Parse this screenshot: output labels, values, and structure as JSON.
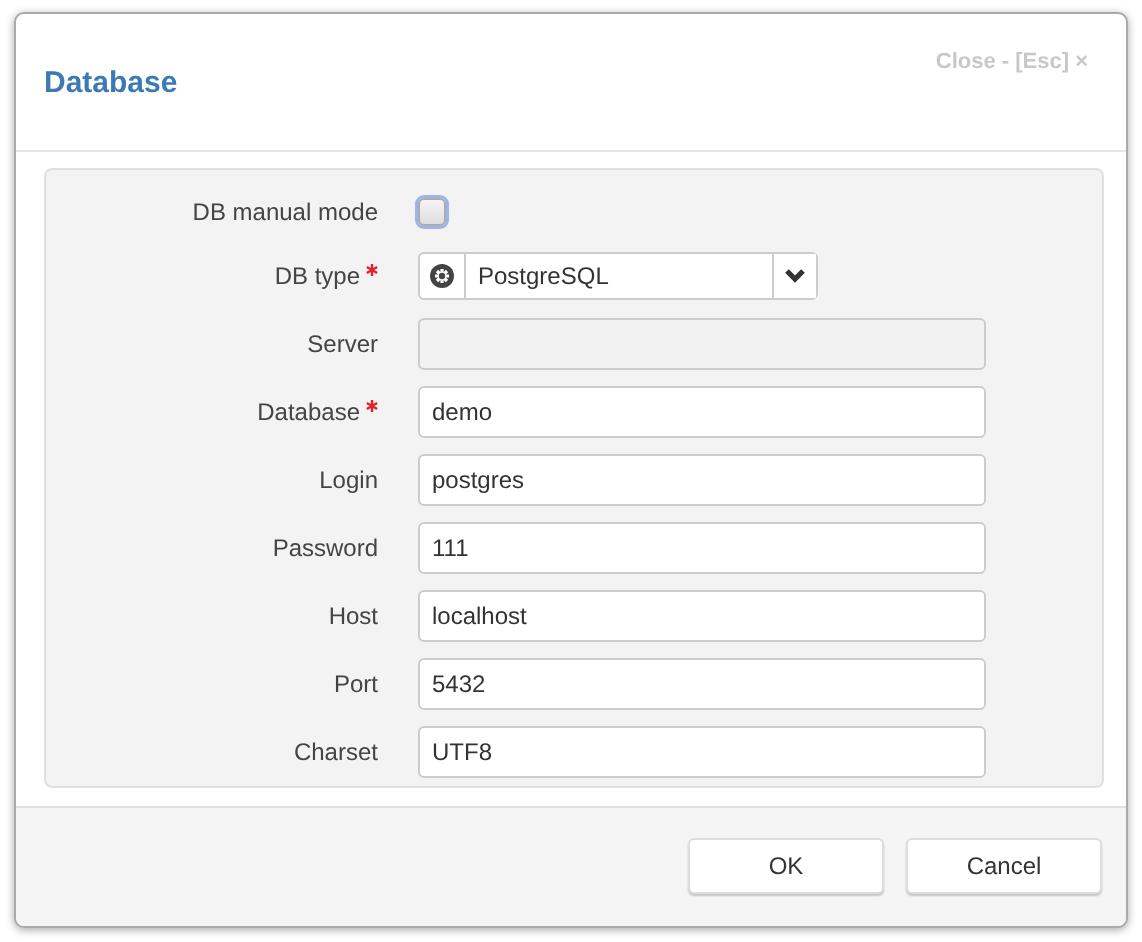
{
  "dialog": {
    "title": "Database",
    "close_label": "Close - [Esc] ×"
  },
  "fields": [
    {
      "kind": "checkbox",
      "label": "DB manual mode",
      "required": false,
      "checked": false
    },
    {
      "kind": "select",
      "label": "DB type",
      "required": true,
      "value": "PostgreSQL"
    },
    {
      "kind": "text",
      "label": "Server",
      "required": false,
      "disabled": true
    },
    {
      "kind": "text",
      "label": "Database",
      "required": true,
      "disabled": false,
      "value": "demo"
    },
    {
      "kind": "text",
      "label": "Login",
      "required": false,
      "disabled": false,
      "value": "postgres"
    },
    {
      "kind": "text",
      "label": "Password",
      "required": false,
      "disabled": false,
      "value": "111"
    },
    {
      "kind": "text",
      "label": "Host",
      "required": false,
      "disabled": false,
      "value": "localhost"
    },
    {
      "kind": "text",
      "label": "Port",
      "required": false,
      "disabled": false,
      "value": "5432"
    },
    {
      "kind": "text",
      "label": "Charset",
      "required": false,
      "disabled": false,
      "value": "UTF8"
    }
  ],
  "buttons": [
    "OK",
    "Cancel"
  ]
}
